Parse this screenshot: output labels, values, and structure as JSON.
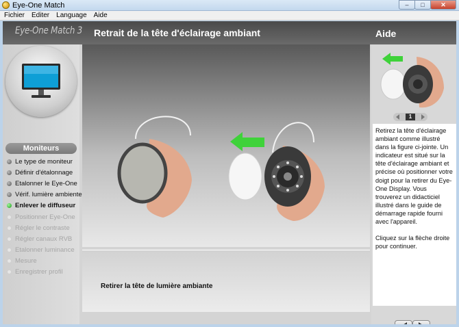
{
  "window": {
    "title": "Eye-One Match",
    "minimize": "–",
    "maximize": "□",
    "close": "✕"
  },
  "menu": [
    "Fichier",
    "Editer",
    "Language",
    "Aide"
  ],
  "app": {
    "logo": "Eye-One Match 3"
  },
  "page": {
    "title": "Retrait de la tête d'éclairage ambiant"
  },
  "sidebar": {
    "section": "Moniteurs",
    "steps": [
      {
        "label": "Le type de moniteur",
        "state": "done"
      },
      {
        "label": "Définir d'étalonnage",
        "state": "done"
      },
      {
        "label": "Etalonner le Eye-One",
        "state": "done"
      },
      {
        "label": "Vérif. lumière ambiente",
        "state": "done"
      },
      {
        "label": "Enlever le diffuseur",
        "state": "active"
      },
      {
        "label": "Positionner Eye-One",
        "state": "disabled"
      },
      {
        "label": "Régler le contraste",
        "state": "disabled"
      },
      {
        "label": "Régler canaux RVB",
        "state": "disabled"
      },
      {
        "label": "Etalonner luminance",
        "state": "disabled"
      },
      {
        "label": "Mesure",
        "state": "disabled"
      },
      {
        "label": "Enregistrer profil",
        "state": "disabled"
      }
    ]
  },
  "caption": "Retirer la tête de lumière ambiante",
  "help": {
    "title": "Aide",
    "page_number": "1",
    "paragraph1": "Retirez la tête d'éclairage ambiant comme illustré dans la figure ci-jointe. Un indicateur est situé sur la tête d'éclairage ambiant et précise où positionner votre doigt pour la retirer du Eye-One Display. Vous trouverez un didacticiel illustré dans le guide de démarrage rapide fourni avec l'appareil.",
    "paragraph2": "Cliquez sur la flèche droite pour continuer."
  },
  "colors": {
    "active_step": "#1c9a18",
    "arrow_green": "#3fd23a",
    "header_gray": "#5a5a5a"
  }
}
